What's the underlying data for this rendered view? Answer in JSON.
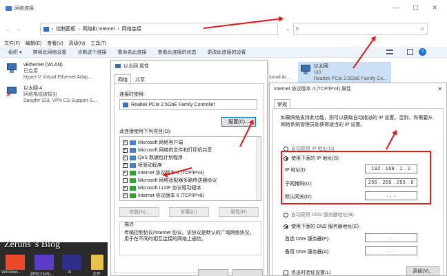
{
  "window": {
    "title": "网络连接",
    "min_glyph": "—",
    "max_glyph": "☐",
    "close_glyph": "✕"
  },
  "address": {
    "back": "←",
    "forward": "→",
    "up": "↑",
    "crumbs": [
      "控制面板",
      "网络和 Internet",
      "网络连接"
    ],
    "sep": "›",
    "dropdown": "⌄",
    "refresh": "↻",
    "search_icon": "⌕"
  },
  "menu": [
    "文件(F)",
    "编辑(E)",
    "查看(V)",
    "高级(N)",
    "工具(T)"
  ],
  "commands": [
    "组织 ▾",
    "禁用此网络设备",
    "诊断这个连接",
    "重命名此连接",
    "查看此连接的状态",
    "更改此连接的设置"
  ],
  "adapters": [
    {
      "name": "vEthernet (WLAN)",
      "status": "已启用",
      "device": "Hyper-V Virtual Ethernet Adap..."
    },
    {
      "name": "以太网 4",
      "status": "网络电缆被拔出",
      "device": "Sangfor SSL VPN CS Support S..."
    },
    {
      "name": "以太网",
      "status": "Ui3",
      "device": "Realtek PCIe 2.5GbE Family Co..."
    }
  ],
  "partial_text": "sonal Ar...",
  "props": {
    "title": "以太网 属性",
    "tabs": [
      "网络",
      "共享"
    ],
    "connect_using_label": "连接时使用:",
    "adapter_name": "Realtek PCIe 2.5GbE Family Controller",
    "config_button": "配置(C)...",
    "items_label": "此连接使用下列项目(O):",
    "items": [
      {
        "label": "Microsoft 网络客户端",
        "checked": true
      },
      {
        "label": "Microsoft 网络的文件和打印机共享",
        "checked": true
      },
      {
        "label": "QoS 数据包计划程序",
        "checked": true
      },
      {
        "label": "桥驱动程序",
        "checked": true
      },
      {
        "label": "Internet 协议版本 4 (TCP/IPv4)",
        "checked": true
      },
      {
        "label": "Microsoft 网络适配器多路传送器协议",
        "checked": false
      },
      {
        "label": "Microsoft LLDP 协议驱动程序",
        "checked": true
      },
      {
        "label": "Internet 协议版本 6 (TCP/IPv6)",
        "checked": true
      }
    ],
    "install_button": "安装(N)...",
    "uninstall_button": "卸载(U)",
    "properties_button": "属性(R)",
    "desc_label": "描述",
    "desc_text": "传输控制协议/Internet 协议。该协议是默认的广域网络协议，用于在不同的相互连接的网络上通信。"
  },
  "ipv4": {
    "title": "Internet 协议版本 4 (TCP/IPv4) 属性",
    "close_glyph": "✕",
    "tab": "常规",
    "intro": "如果网络支持此功能，则可以获取自动指派的 IP 设置。否则，你需要从网络系统管理员处获得适当的 IP 设置。",
    "auto_ip": "自动获得 IP 地址(O)",
    "manual_ip": "使用下面的 IP 地址(S):",
    "ip_label": "IP 地址(I):",
    "ip_value": "192 . 168 . 1 . 2",
    "mask_label": "子网掩码(U):",
    "mask_value": "255 . 255 . 255 . 0",
    "gw_label": "默认网关(D):",
    "gw_value": ".   .   .",
    "auto_dns": "自动获得 DNS 服务器地址(B)",
    "manual_dns": "使用下面的 DNS 服务器地址(E):",
    "dns1_label": "首选 DNS 服务器(P):",
    "dns2_label": "备用 DNS 服务器(A):",
    "dns_value": ".   .   .",
    "validate_label": "退出时验证设置(L)",
    "advanced_button": "高级(V)..."
  },
  "taskbar": {
    "watermark": "Zeruns 's Blog",
    "items": [
      "Windows...",
      "好压(2345)...",
      "Ai",
      "文件"
    ]
  },
  "colors": {
    "accent": "#0078d7",
    "highlight_border": "#e01a1a",
    "arrow": "#e01a1a"
  }
}
